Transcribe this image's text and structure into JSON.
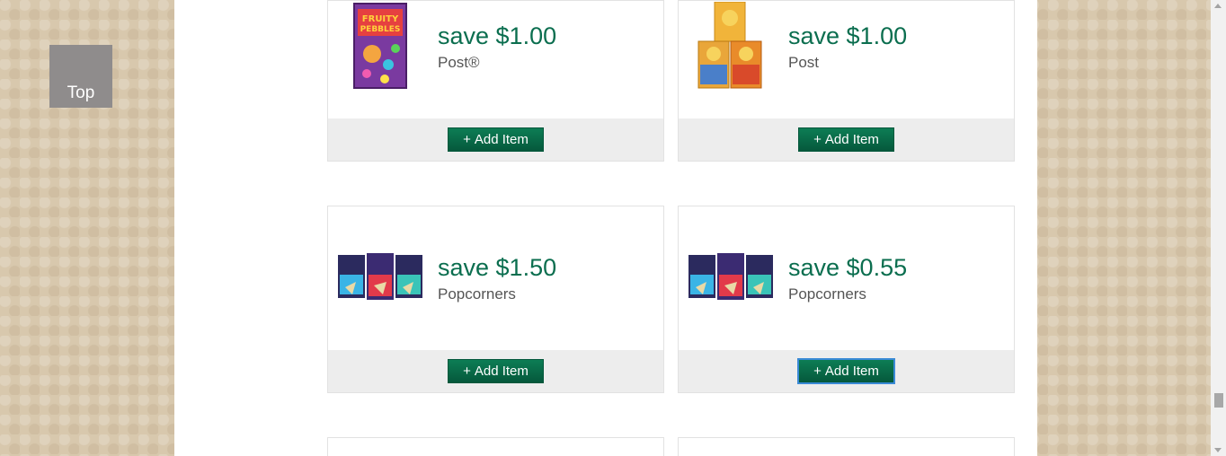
{
  "top_button": {
    "label": "Top"
  },
  "coupons": [
    {
      "save": "save $1.00",
      "brand": "Post®",
      "button": "Add Item",
      "image": "fruity-pebbles-cereal-box"
    },
    {
      "save": "save $1.00",
      "brand": "Post",
      "button": "Add Item",
      "image": "honey-bunches-of-oats-boxes"
    },
    {
      "save": "save $1.50",
      "brand": "Popcorners",
      "button": "Add Item",
      "image": "popcorners-bags"
    },
    {
      "save": "save $0.55",
      "brand": "Popcorners",
      "button": "Add Item",
      "image": "popcorners-bags"
    }
  ],
  "colors": {
    "accent_green": "#0b6e4f",
    "button_green": "#05583c",
    "page_bg": "#d8c8ad"
  }
}
